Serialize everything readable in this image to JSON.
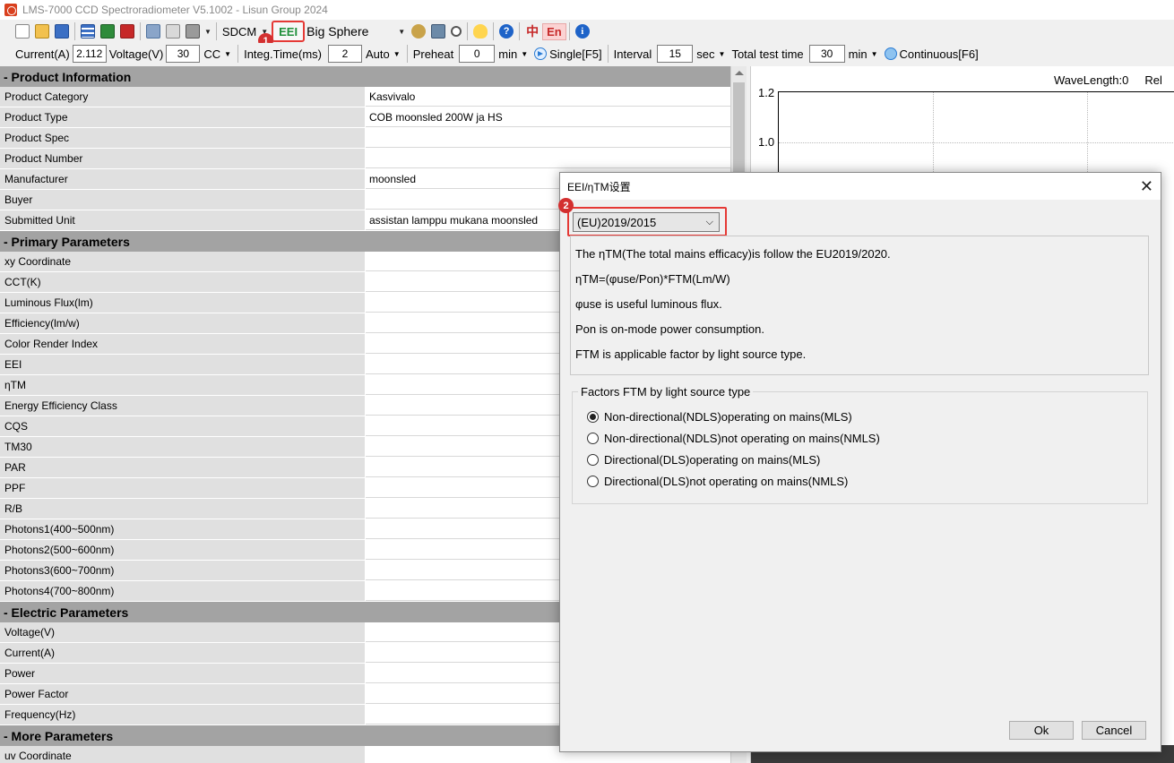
{
  "window": {
    "title": "LMS-7000 CCD Spectroradiometer V5.1002 - Lisun Group 2024"
  },
  "toolbar": {
    "sdcm_label": "SDCM",
    "eei_label": "EEI",
    "sphere_label": "Big Sphere",
    "lang_cn": "中",
    "lang_en": "En",
    "callout1": "1",
    "callout2": "2"
  },
  "params": {
    "current_label": "Current(A)",
    "current_value": "2.112",
    "voltage_label": "Voltage(V)",
    "voltage_value": "30",
    "mode_label": "CC",
    "integ_label": "Integ.Time(ms)",
    "integ_value": "2",
    "auto_label": "Auto",
    "preheat_label": "Preheat",
    "preheat_value": "0",
    "preheat_unit": "min",
    "single_label": "Single[F5]",
    "interval_label": "Interval",
    "interval_value": "15",
    "interval_unit": "sec",
    "total_label": "Total test time",
    "total_value": "30",
    "total_unit": "min",
    "continuous_label": "Continuous[F6]"
  },
  "sections": {
    "product": "- Product Information",
    "primary": "- Primary Parameters",
    "electric": "- Electric Parameters",
    "more": "- More Parameters"
  },
  "product_rows": [
    {
      "label": "Product Category",
      "value": "Kasvivalo"
    },
    {
      "label": "Product Type",
      "value": "COB moonsled 200W ja HS"
    },
    {
      "label": "Product Spec",
      "value": ""
    },
    {
      "label": "Product Number",
      "value": ""
    },
    {
      "label": "Manufacturer",
      "value": "moonsled"
    },
    {
      "label": "Buyer",
      "value": ""
    },
    {
      "label": "Submitted Unit",
      "value": "assistan lamppu mukana moonsled"
    }
  ],
  "primary_rows": [
    "xy Coordinate",
    "CCT(K)",
    "Luminous Flux(lm)",
    "Efficiency(lm/w)",
    "Color Render Index",
    "EEI",
    "ηTM",
    "Energy Efficiency Class",
    "CQS",
    "TM30",
    "PAR",
    "PPF",
    "R/B",
    "Photons1(400~500nm)",
    "Photons2(500~600nm)",
    "Photons3(600~700nm)",
    "Photons4(700~800nm)"
  ],
  "electric_rows": [
    "Voltage(V)",
    "Current(A)",
    "Power",
    "Power Factor",
    "Frequency(Hz)"
  ],
  "more_rows": [
    "uv Coordinate"
  ],
  "chart": {
    "wavelength": "WaveLength:0",
    "rel": "Rel",
    "tick_12": "1.2",
    "tick_10": "1.0"
  },
  "dialog": {
    "title": "EEI/ηTM设置",
    "close": "✕",
    "standard": "(EU)2019/2015",
    "lines": [
      "The ηTM(The total mains efficacy)is follow the EU2019/2020.",
      "ηTM=(φuse/Pon)*FTM(Lm/W)",
      "φuse is useful luminous flux.",
      "Pon is on-mode power consumption.",
      "FTM is applicable factor by light source type."
    ],
    "factors_legend": "Factors FTM by light source type",
    "options": [
      "Non-directional(NDLS)operating on mains(MLS)",
      "Non-directional(NDLS)not operating on mains(NMLS)",
      "Directional(DLS)operating on mains(MLS)",
      "Directional(DLS)not operating on mains(NMLS)"
    ],
    "selected_option": 0,
    "ok": "Ok",
    "cancel": "Cancel"
  }
}
